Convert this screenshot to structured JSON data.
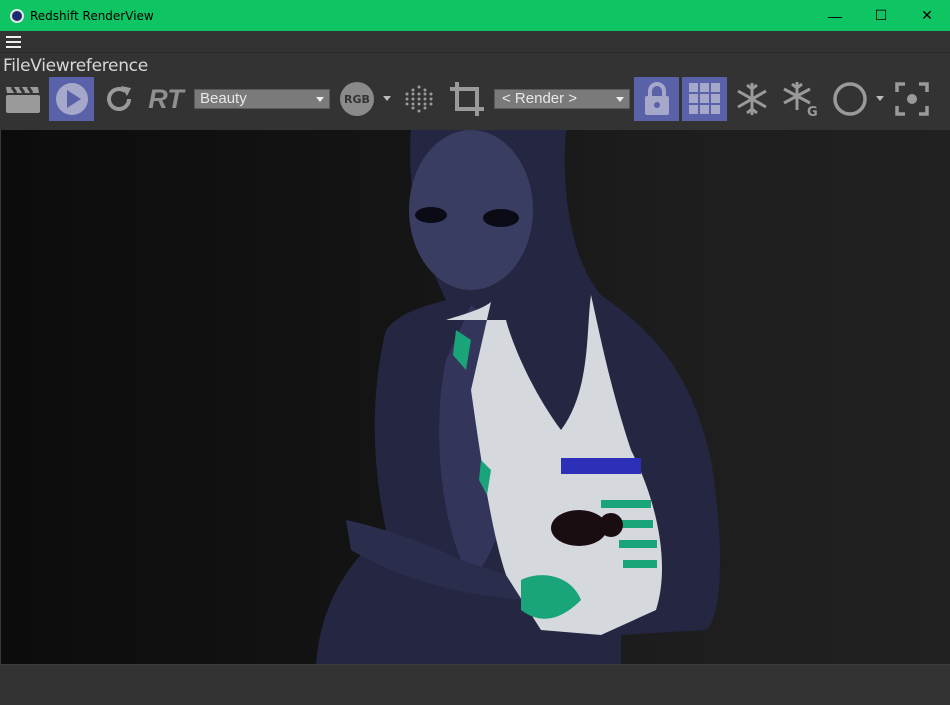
{
  "window": {
    "title": "Redshift RenderView",
    "minimize_glyph": "—",
    "maximize_glyph": "☐",
    "close_glyph": "✕"
  },
  "menu": {
    "file": "File",
    "view": "View",
    "reference": "reference"
  },
  "toolbar": {
    "rt_label": "RT",
    "aov_select": "Beauty",
    "rgb_label": "RGB",
    "camera_select": "< Render >"
  },
  "colors": {
    "titlebar": "#0fc463",
    "active_button": "#5961a8",
    "icon": "#9a9a9a"
  },
  "icons": [
    "menu-icon",
    "clapperboard-icon",
    "play-icon",
    "refresh-icon",
    "rgb-channel-icon",
    "dots-grid-icon",
    "crop-icon",
    "lock-icon",
    "grid-icon",
    "snowflake-icon",
    "snowflake-g-icon",
    "circle-icon",
    "focus-icon"
  ]
}
